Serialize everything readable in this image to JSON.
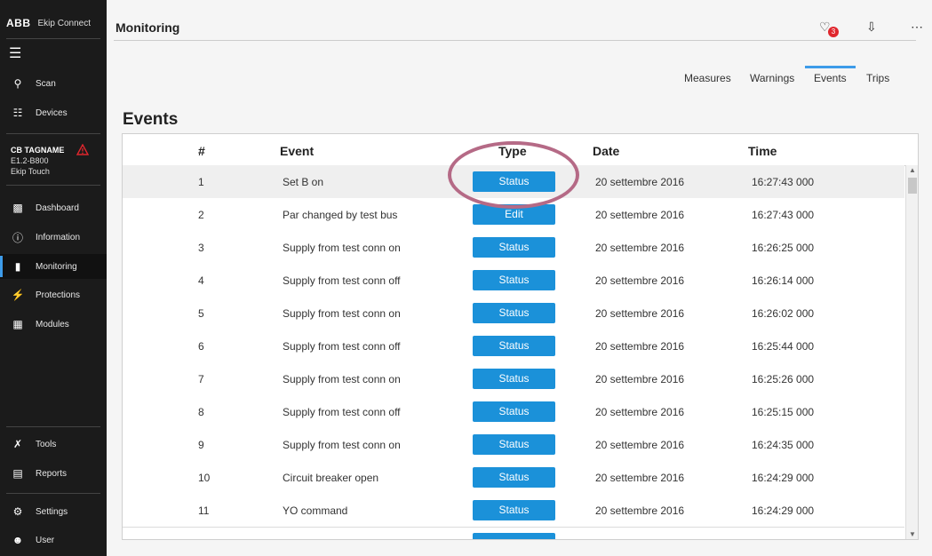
{
  "app": {
    "brand": "ABB",
    "name": "Ekip Connect"
  },
  "sidebar": {
    "top_items": [
      {
        "label": "Scan",
        "icon": "search-icon"
      },
      {
        "label": "Devices",
        "icon": "network-icon"
      }
    ],
    "device": {
      "name": "CB TAGNAME",
      "model": "E1.2-B800",
      "unit": "Ekip Touch"
    },
    "items": [
      {
        "label": "Dashboard",
        "icon": "dashboard-icon"
      },
      {
        "label": "Information",
        "icon": "info-icon"
      },
      {
        "label": "Monitoring",
        "icon": "bar-chart-icon"
      },
      {
        "label": "Protections",
        "icon": "lightning-icon"
      },
      {
        "label": "Modules",
        "icon": "modules-grid-icon"
      }
    ],
    "bottom_items": [
      {
        "label": "Tools",
        "icon": "tools-icon"
      },
      {
        "label": "Reports",
        "icon": "report-icon"
      },
      {
        "label": "Settings",
        "icon": "gear-icon"
      },
      {
        "label": "User",
        "icon": "user-icon"
      }
    ]
  },
  "header": {
    "title": "Monitoring",
    "notification_count": "3"
  },
  "tabs": [
    "Measures",
    "Warnings",
    "Events",
    "Trips"
  ],
  "active_tab": "Events",
  "section_title": "Events",
  "table": {
    "columns": [
      "#",
      "Event",
      "Type",
      "Date",
      "Time"
    ],
    "rows": [
      {
        "n": "1",
        "event": "Set B on",
        "type": "Status",
        "date": "20 settembre 2016",
        "time": "16:27:43 000"
      },
      {
        "n": "2",
        "event": "Par changed by test bus",
        "type": "Edit",
        "date": "20 settembre 2016",
        "time": "16:27:43 000"
      },
      {
        "n": "3",
        "event": "Supply from test conn on",
        "type": "Status",
        "date": "20 settembre 2016",
        "time": "16:26:25 000"
      },
      {
        "n": "4",
        "event": "Supply from test conn off",
        "type": "Status",
        "date": "20 settembre 2016",
        "time": "16:26:14 000"
      },
      {
        "n": "5",
        "event": "Supply from test conn on",
        "type": "Status",
        "date": "20 settembre 2016",
        "time": "16:26:02 000"
      },
      {
        "n": "6",
        "event": "Supply from test conn off",
        "type": "Status",
        "date": "20 settembre 2016",
        "time": "16:25:44 000"
      },
      {
        "n": "7",
        "event": "Supply from test conn on",
        "type": "Status",
        "date": "20 settembre 2016",
        "time": "16:25:26 000"
      },
      {
        "n": "8",
        "event": "Supply from test conn off",
        "type": "Status",
        "date": "20 settembre 2016",
        "time": "16:25:15 000"
      },
      {
        "n": "9",
        "event": "Supply from test conn on",
        "type": "Status",
        "date": "20 settembre 2016",
        "time": "16:24:35 000"
      },
      {
        "n": "10",
        "event": "Circuit breaker open",
        "type": "Status",
        "date": "20 settembre 2016",
        "time": "16:24:29 000"
      },
      {
        "n": "11",
        "event": "YO command",
        "type": "Status",
        "date": "20 settembre 2016",
        "time": "16:24:29 000"
      }
    ]
  },
  "colors": {
    "accent": "#1b91d9",
    "sidebar": "#1b1b1b",
    "alert": "#e0262d",
    "highlight": "#b56a86"
  }
}
